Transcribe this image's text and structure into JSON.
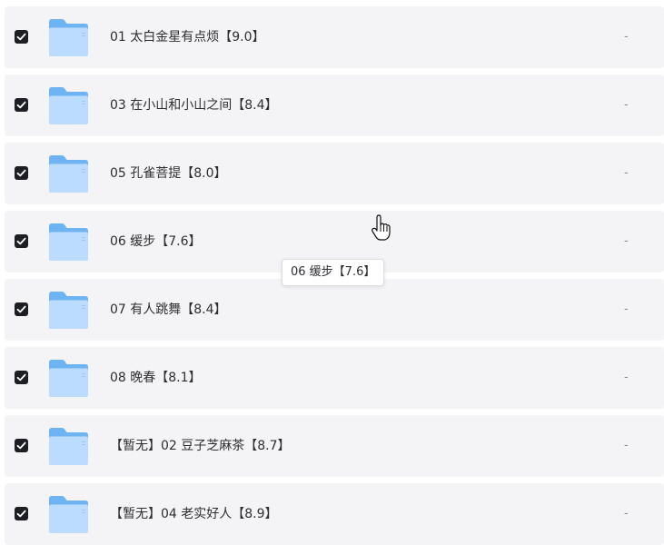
{
  "files": [
    {
      "name": "01 太白金星有点烦【9.0】",
      "size": "-",
      "checked": true
    },
    {
      "name": "03 在小山和小山之间【8.4】",
      "size": "-",
      "checked": true
    },
    {
      "name": "05 孔雀菩提【8.0】",
      "size": "-",
      "checked": true
    },
    {
      "name": "06 缓步【7.6】",
      "size": "-",
      "checked": true
    },
    {
      "name": "07 有人跳舞【8.4】",
      "size": "-",
      "checked": true
    },
    {
      "name": "08 晚春【8.1】",
      "size": "-",
      "checked": true
    },
    {
      "name": "【暂无】02 豆子芝麻茶【8.7】",
      "size": "-",
      "checked": true
    },
    {
      "name": "【暂无】04 老实好人【8.9】",
      "size": "-",
      "checked": true
    }
  ],
  "tooltip": {
    "text": "06 缓步【7.6】"
  },
  "icons": {
    "checkbox": "checkmark-icon",
    "folder": "folder-icon",
    "cursor": "hand-pointer-icon"
  },
  "colors": {
    "row_bg": "#f4f4f6",
    "checkbox_bg": "#1d1d24",
    "folder_light": "#bcdcff",
    "folder_dark": "#6fb4f2"
  }
}
